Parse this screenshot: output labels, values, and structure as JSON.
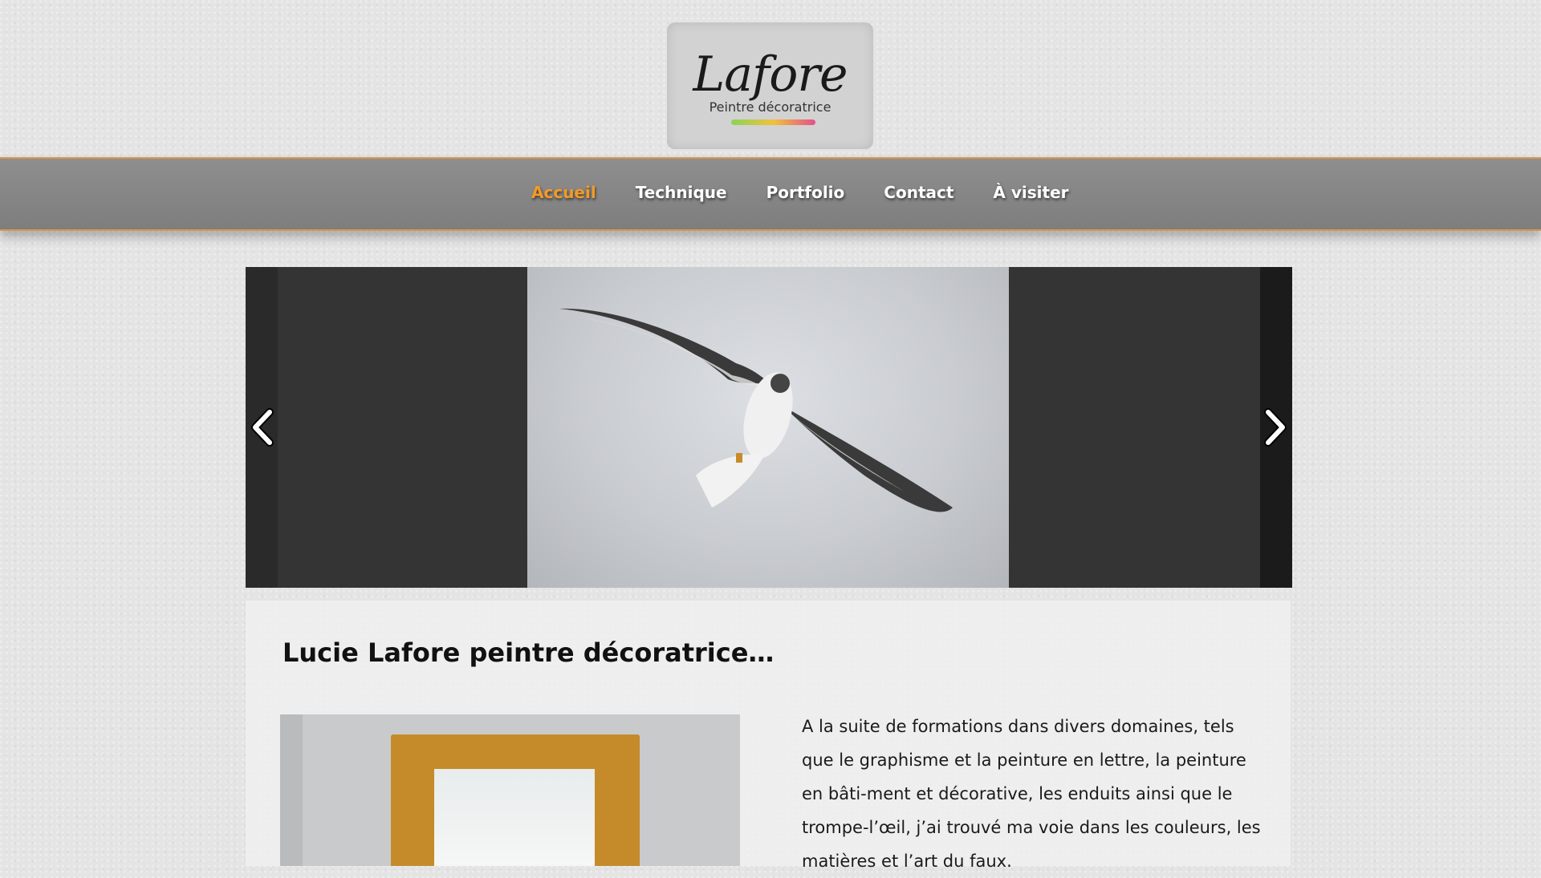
{
  "logo": {
    "script": "Lafore",
    "subtitle": "Peintre décoratrice",
    "accent_colors": [
      "#8bd35a",
      "#f0c23a",
      "#e4508c"
    ]
  },
  "nav": {
    "items": [
      {
        "label": "Accueil",
        "active": true
      },
      {
        "label": "Technique",
        "active": false
      },
      {
        "label": "Portfolio",
        "active": false
      },
      {
        "label": "Contact",
        "active": false
      },
      {
        "label": "À visiter",
        "active": false
      }
    ],
    "active_color": "#f39a28",
    "border_color": "#d89552"
  },
  "slider": {
    "prev_icon": "chevron-left-icon",
    "next_icon": "chevron-right-icon",
    "image": "eagle-painting"
  },
  "main": {
    "title": "Lucie Lafore peintre décoratrice…",
    "intro_text": "A la suite de formations dans divers domaines, tels que le graphisme et la peinture en lettre, la peinture en bâti-ment et décorative, les enduits ainsi que le trompe-l’œil, j’ai trouvé ma voie dans les couleurs, les matières et l’art du faux."
  }
}
